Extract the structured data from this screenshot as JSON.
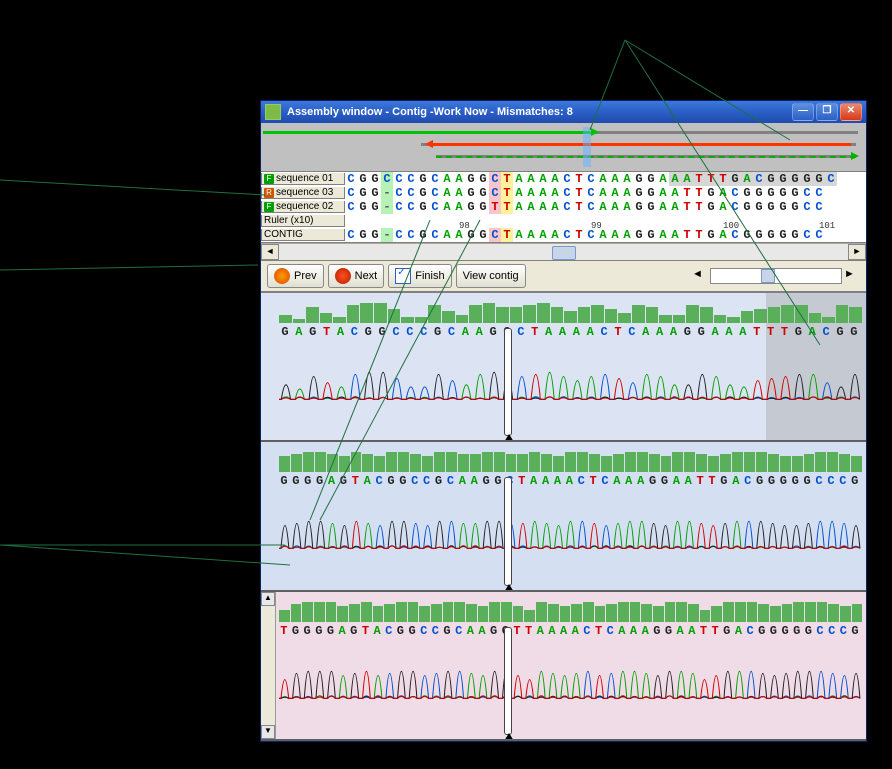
{
  "window": {
    "title": "Assembly window - Contig -Work Now  -  Mismatches: 8"
  },
  "overview": {
    "cursor_pos_pct": 55
  },
  "alignment": {
    "rows": [
      {
        "dir": "F",
        "label": "sequence 01",
        "seq": "CGGCCCGCAAGGCTAAAACTCAAAGGAAATTTGACGGGGGC"
      },
      {
        "dir": "R",
        "label": "sequence 03",
        "seq": "CGG-CCGCAAGGCTAAAACTCAAAGGAATTGACGGGGGCC"
      },
      {
        "dir": "F",
        "label": "sequence 02",
        "seq": "CGG-CCGCAAGGTTAAAACTCAAAGGAATTGACGGGGGCC"
      }
    ],
    "ruler_label": "Ruler (x10)",
    "ruler_marks": [
      98,
      99,
      100,
      101
    ],
    "contig_label": "CONTIG",
    "contig_seq": "CGG-CCGCAAGGCTAAAACTCAAAGGAATTGACGGGGGCC",
    "highlight_cols": {
      "3": "green",
      "12": "pink",
      "13": "yellow"
    },
    "gray_region_start": 27
  },
  "toolbar": {
    "prev": "Prev",
    "next": "Next",
    "finish": "Finish",
    "view_contig": "View contig"
  },
  "chromatograms": [
    {
      "bg": "cp-blue",
      "has_gray": true,
      "seq": "GAGTACGGCCCGCAAGGCTAAAACTCAAAGGAAATTTGACGG",
      "quality": [
        4,
        2,
        8,
        5,
        3,
        9,
        10,
        10,
        7,
        3,
        3,
        9,
        6,
        4,
        9,
        10,
        8,
        8,
        9,
        10,
        8,
        6,
        8,
        9,
        7,
        5,
        9,
        8,
        4,
        4,
        9,
        8,
        4,
        3,
        6,
        7,
        8,
        9,
        9,
        5,
        3,
        9,
        8
      ]
    },
    {
      "bg": "cp-blue2",
      "has_gray": false,
      "seq": "GGGGAGTACGGCCGCAAGGCTAAAACTCAAAGGAATTGACGGGGGCCCG",
      "quality": [
        8,
        9,
        10,
        10,
        9,
        8,
        10,
        9,
        8,
        10,
        10,
        9,
        8,
        10,
        10,
        9,
        9,
        10,
        10,
        9,
        9,
        10,
        9,
        8,
        10,
        10,
        9,
        8,
        9,
        10,
        10,
        9,
        8,
        10,
        10,
        9,
        8,
        9,
        10,
        10,
        10,
        9,
        8,
        8,
        9,
        10,
        10,
        9,
        8
      ]
    },
    {
      "bg": "cp-pink",
      "has_gray": false,
      "seq": "TGGGGAGTACGGCCGCAAGGTTAAAACTCAAAGGAATTGACGGGGGCCCG",
      "quality": [
        6,
        9,
        10,
        10,
        10,
        8,
        9,
        10,
        8,
        9,
        10,
        10,
        8,
        9,
        10,
        10,
        9,
        8,
        10,
        10,
        8,
        6,
        10,
        9,
        8,
        9,
        10,
        8,
        9,
        10,
        10,
        9,
        8,
        10,
        10,
        9,
        6,
        8,
        10,
        10,
        10,
        9,
        8,
        9,
        10,
        10,
        10,
        9,
        8,
        9
      ]
    }
  ]
}
